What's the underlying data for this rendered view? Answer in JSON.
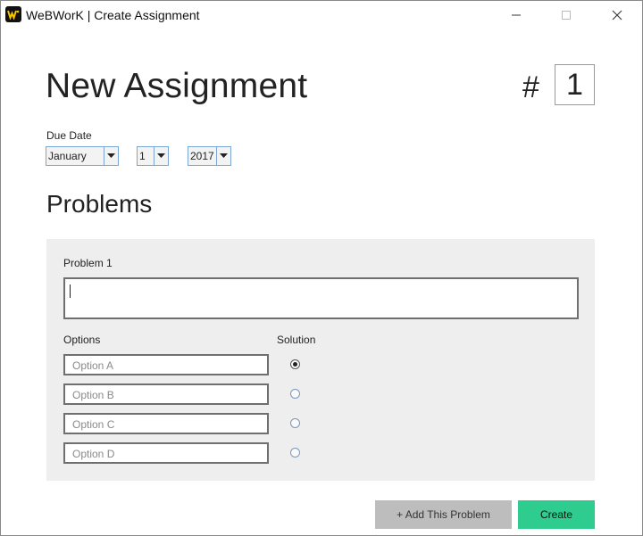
{
  "window": {
    "title": "WeBWorK | Create Assignment"
  },
  "header": {
    "title": "New Assignment",
    "hash_symbol": "#",
    "assignment_number": "1"
  },
  "due_date": {
    "label": "Due Date",
    "month": "January",
    "day": "1",
    "year": "2017"
  },
  "problems": {
    "section_title": "Problems",
    "problem_label": "Problem 1",
    "problem_text": "",
    "options_label": "Options",
    "solution_label": "Solution",
    "options": [
      {
        "placeholder": "Option A",
        "value": "",
        "selected": true
      },
      {
        "placeholder": "Option B",
        "value": "",
        "selected": false
      },
      {
        "placeholder": "Option C",
        "value": "",
        "selected": false
      },
      {
        "placeholder": "Option D",
        "value": "",
        "selected": false
      }
    ]
  },
  "actions": {
    "add_problem_label": "+ Add This Problem",
    "create_label": "Create"
  },
  "colors": {
    "create_button": "#2ecc8f",
    "add_button": "#bdbdbd",
    "panel_background": "#eeeeee"
  },
  "icons": {
    "app": "webwork-logo-icon",
    "minimize": "minimize-icon",
    "maximize": "maximize-icon",
    "close": "close-icon",
    "dropdown": "chevron-down-icon"
  }
}
